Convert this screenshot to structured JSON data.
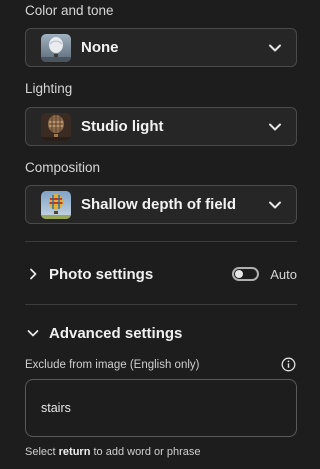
{
  "color_tone": {
    "label": "Color and tone",
    "value": "None"
  },
  "lighting": {
    "label": "Lighting",
    "value": "Studio light"
  },
  "composition": {
    "label": "Composition",
    "value": "Shallow depth of field"
  },
  "photo_settings": {
    "title": "Photo settings",
    "expanded": false,
    "toggle_on": false,
    "toggle_label": "Auto"
  },
  "advanced_settings": {
    "title": "Advanced settings",
    "expanded": true,
    "exclude_label": "Exclude from image (English only)",
    "exclude_value": "stairs",
    "hint_prefix": "Select",
    "hint_key": "return",
    "hint_suffix": "to add word or phrase"
  },
  "icons": {
    "dropdown": "chevron-down-icon",
    "collapsed": "chevron-right-icon",
    "expanded": "chevron-down-icon",
    "info": "info-icon"
  }
}
